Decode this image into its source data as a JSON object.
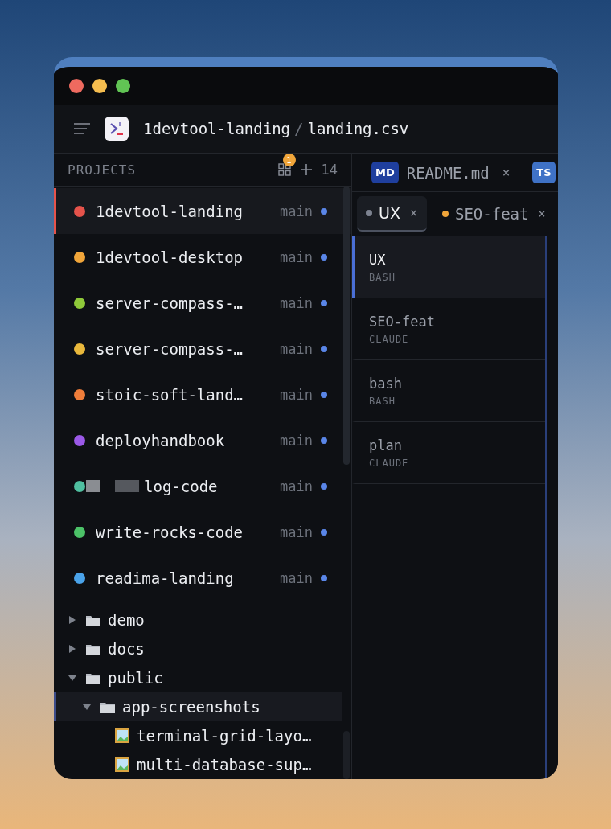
{
  "breadcrumb": {
    "project": "1devtool-landing",
    "separator": "/",
    "file": "landing.csv"
  },
  "projects_header": {
    "title": "PROJECTS",
    "badge": "1",
    "count": "14"
  },
  "projects": [
    {
      "name": "1devtool-landing",
      "branch": "main",
      "color": "#e5534b",
      "selected": true,
      "redacted": false
    },
    {
      "name": "1devtool-desktop",
      "branch": "main",
      "color": "#f0a53a",
      "selected": false,
      "redacted": false
    },
    {
      "name": "server-compass-…",
      "branch": "main",
      "color": "#8fc93a",
      "selected": false,
      "redacted": false
    },
    {
      "name": "server-compass-…",
      "branch": "main",
      "color": "#e9b83c",
      "selected": false,
      "redacted": false
    },
    {
      "name": "stoic-soft-land…",
      "branch": "main",
      "color": "#ef7d3a",
      "selected": false,
      "redacted": false
    },
    {
      "name": "deployhandbook",
      "branch": "main",
      "color": "#9b59e8",
      "selected": false,
      "redacted": false
    },
    {
      "name": "log-code",
      "branch": "main",
      "color": "#4fbfa0",
      "selected": false,
      "redacted": true
    },
    {
      "name": "write-rocks-code",
      "branch": "main",
      "color": "#4cc268",
      "selected": false,
      "redacted": false
    },
    {
      "name": "readima-landing",
      "branch": "main",
      "color": "#4aa3ea",
      "selected": false,
      "redacted": false
    }
  ],
  "tree": [
    {
      "name": "demo",
      "kind": "folder",
      "expanded": false,
      "selected": false
    },
    {
      "name": "docs",
      "kind": "folder",
      "expanded": false,
      "selected": false
    },
    {
      "name": "public",
      "kind": "folder",
      "expanded": true,
      "selected": false,
      "children": [
        {
          "name": "app-screenshots",
          "kind": "folder",
          "expanded": true,
          "selected": true,
          "children": [
            {
              "name": "terminal-grid-layo…",
              "kind": "image",
              "selected": false
            },
            {
              "name": "multi-database-sup…",
              "kind": "image",
              "selected": false
            }
          ]
        }
      ]
    }
  ],
  "file_tabs": [
    {
      "badge": "MD",
      "label": "README.md",
      "close": "×",
      "color": "#1f3f9e"
    },
    {
      "badge": "TS",
      "color": "#3f72c6"
    }
  ],
  "terminal_tabs": [
    {
      "label": "UX",
      "close": "×",
      "color": "#7d8390",
      "selected": true
    },
    {
      "label": "SEO-feat",
      "close": "×",
      "color": "#f0a53a",
      "selected": false
    }
  ],
  "sessions": [
    {
      "name": "UX",
      "type": "BASH",
      "selected": true
    },
    {
      "name": "SEO-feat",
      "type": "CLAUDE",
      "selected": false
    },
    {
      "name": "bash",
      "type": "BASH",
      "selected": false
    },
    {
      "name": "plan",
      "type": "CLAUDE",
      "selected": false
    }
  ]
}
